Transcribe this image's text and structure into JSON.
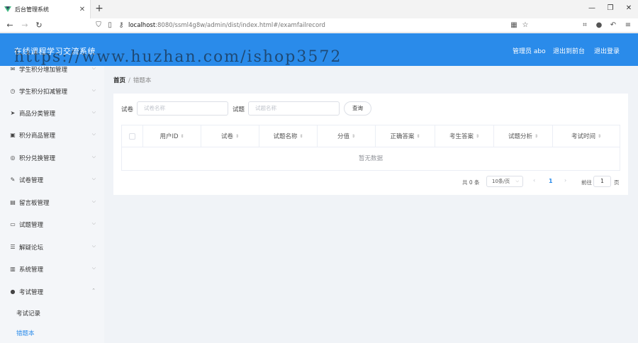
{
  "browser": {
    "tab_title": "后台管理系统",
    "tab_close": "✕",
    "new_tab": "+",
    "url_host": "localhost",
    "url_rest": ":8080/ssml4g8w/admin/dist/index.html#/examfailrecord"
  },
  "header": {
    "title": "在线课程学习交流系统",
    "user_label": "管理员 abo",
    "front_link": "退出到前台",
    "logout_link": "退出登录",
    "watermark": "https://www.huzhan.com/ishop3572",
    "bg_color": "#2a8bea"
  },
  "sidebar": {
    "items": [
      {
        "label": "学生积分增加管理",
        "icon": "mail-icon"
      },
      {
        "label": "学生积分扣减管理",
        "icon": "clock-icon"
      },
      {
        "label": "商品分类管理",
        "icon": "send-icon"
      },
      {
        "label": "积分商品管理",
        "icon": "bag-icon"
      },
      {
        "label": "积分兑换管理",
        "icon": "compass-icon"
      },
      {
        "label": "试卷管理",
        "icon": "brush-icon"
      },
      {
        "label": "留言板管理",
        "icon": "clipboard-icon"
      },
      {
        "label": "试题管理",
        "icon": "monitor-icon"
      },
      {
        "label": "解疑论坛",
        "icon": "menu-icon"
      },
      {
        "label": "系统管理",
        "icon": "chart-icon"
      },
      {
        "label": "考试管理",
        "icon": "pin-icon"
      }
    ],
    "sub_items": [
      {
        "label": "考试记录",
        "active": false
      },
      {
        "label": "错题本",
        "active": true
      }
    ]
  },
  "breadcrumb": {
    "home": "首页",
    "separator": "/",
    "current": "错题本"
  },
  "filters": {
    "paper_label": "试卷",
    "paper_placeholder": "试卷名称",
    "question_label": "试题",
    "question_placeholder": "试题名称",
    "query_button": "查询"
  },
  "table": {
    "columns": [
      "用户ID",
      "试卷",
      "试题名称",
      "分值",
      "正确答案",
      "考生答案",
      "试题分析",
      "考试时间"
    ],
    "sort_icon": "⇕",
    "empty_text": "暂无数据"
  },
  "pagination": {
    "total": "共 0 条",
    "page_size": "10条/页",
    "current_page": "1",
    "goto_label": "前往",
    "goto_value": "1",
    "page_suffix": "页"
  }
}
